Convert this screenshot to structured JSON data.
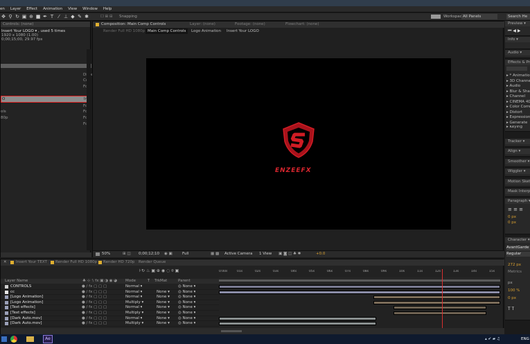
{
  "menu": [
    "en",
    "Layer",
    "Effect",
    "Animation",
    "View",
    "Window",
    "Help"
  ],
  "toolbar": {
    "snapping": "Snapping",
    "workspace_label": "Workspace:",
    "workspace_value": "All Panels",
    "search": "Search He"
  },
  "left_panel": {
    "title": "Controls: (none)",
    "comp_name": "Insert Your LOGO ▾ , used 5 times",
    "dims": "1920 x 1080 (1.00)",
    "duration": "0;00;15;00, 29.97 fps",
    "col_header": "Dimensi",
    "rows": [
      {
        "name": "",
        "val": "Co"
      },
      {
        "name": "",
        "val": "Fo"
      },
      {
        "name": "",
        "val": "In"
      },
      {
        "name": "O",
        "val": "In"
      },
      {
        "name": "",
        "val": "Fo"
      },
      {
        "name": "ols",
        "val": "Fo"
      },
      {
        "name": "80p",
        "val": "Fo"
      },
      {
        "name": "",
        "val": "Fo"
      }
    ]
  },
  "viewer": {
    "tabs": [
      "Composition: Main Comp Controls",
      "Layer: (none)",
      "Footage: (none)",
      "Flowchart: (none)"
    ],
    "breadcrumbs": [
      "Render Full HD 1080p",
      "Main Comp Controls",
      "Logo Animation",
      "Insert Your LOGO"
    ],
    "logo_text": "ENZEEFX",
    "footer": {
      "zoom": "50%",
      "timecode": "0;00;12;10",
      "quality": "Full",
      "camera": "Active Camera",
      "view": "1 View",
      "exposure": "+0.0"
    }
  },
  "right_panels": {
    "preview": "Preview ▾",
    "info": "Info ▾",
    "audio": "Audio ▾",
    "effects": "Effects & Pre",
    "effects_list": [
      "▸ * Animation",
      "▸ 3D Channel",
      "▸ Audio",
      "▸ Blur & Sharpe",
      "▸ Channel",
      "▸ CINEMA 4D",
      "▸ Color Correc",
      "▸ Distort",
      "▸ Expression C",
      "▸ Generate",
      "▸ Keying"
    ],
    "tracker": "Tracker ▾",
    "align": "Align ▾",
    "smoother": "Smoother ▾",
    "wiggler": "Wiggler ▾",
    "motion_sketch": "Motion Sket",
    "mask_interp": "Mask Interpo",
    "paragraph": "Paragraph ▾",
    "para_vals": [
      "0 px",
      "0 px"
    ],
    "character": "Character ▾",
    "font": "AvantGarde Ce",
    "style": "Regular",
    "char_vals": [
      "272 px",
      "Metrics",
      "px",
      "100 %",
      "0 px"
    ]
  },
  "timeline": {
    "tabs": [
      "Insert Your TEXT",
      "Render Full HD 1080p",
      "Render HD 720p",
      "Render Queue"
    ],
    "col_headers": [
      "Layer Name",
      "Mode",
      "T",
      "TrkMat",
      "Parent"
    ],
    "layers": [
      {
        "name": "CONTROLS",
        "mode": "Normal",
        "trk": "",
        "parent": "None",
        "color": "#d0d0d0"
      },
      {
        "name": "cc",
        "mode": "Normal",
        "trk": "None",
        "parent": "None",
        "color": "#e8e8e8"
      },
      {
        "name": "[Logo Animation]",
        "mode": "Normal",
        "trk": "None",
        "parent": "None",
        "color": "#9aa0b8"
      },
      {
        "name": "[Logo Animation]",
        "mode": "Multiply",
        "trk": "None",
        "parent": "None",
        "color": "#9aa0b8"
      },
      {
        "name": "[Text effects]",
        "mode": "Normal",
        "trk": "None",
        "parent": "None",
        "color": "#9aa0b8"
      },
      {
        "name": "[Text effects]",
        "mode": "Multiply",
        "trk": "None",
        "parent": "None",
        "color": "#9aa0b8"
      },
      {
        "name": "[Dark Auto.mov]",
        "mode": "Normal",
        "trk": "None",
        "parent": "None",
        "color": "#9aa0b8"
      },
      {
        "name": "[Dark Auto.mov]",
        "mode": "Multiply",
        "trk": "None",
        "parent": "None",
        "color": "#9aa0b8"
      }
    ],
    "ruler": [
      "0:00s",
      "01s",
      "02s",
      "03s",
      "04s",
      "05s",
      "06s",
      "07s",
      "08s",
      "09s",
      "10s",
      "11s",
      "12s",
      "13s",
      "14s",
      "15s"
    ],
    "playhead_s": 12.4
  },
  "taskbar": {
    "lang": "ENG"
  }
}
